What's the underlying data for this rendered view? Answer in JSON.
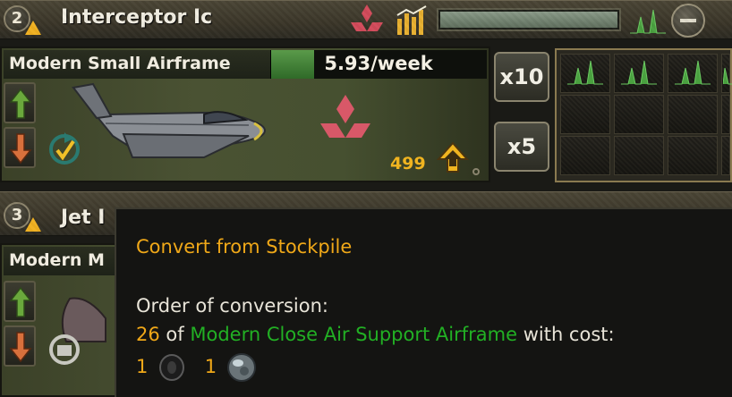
{
  "rows": [
    {
      "priority": "2",
      "title": "Interceptor Ic",
      "equipment_name": "Modern Small Airframe",
      "production_rate": "5.93/week",
      "stockpile_count": "499",
      "progress_fraction": 0.2
    },
    {
      "priority": "3",
      "title": "Jet I",
      "equipment_name": "Modern M"
    }
  ],
  "buttons": {
    "x10": "x10",
    "x5": "x5"
  },
  "tooltip": {
    "title": "Convert from Stockpile",
    "order_label": "Order of conversion:",
    "count": "26",
    "of_text": "of",
    "source_equipment": "Modern Close Air Support Airframe",
    "with_cost": "with cost:",
    "cost_1": "1",
    "cost_2": "1"
  },
  "icons": [
    "up-arrow-icon",
    "down-arrow-icon",
    "upgrade-cycle-icon",
    "mitsubishi-logo-icon",
    "efficiency-chart-icon",
    "minus-icon",
    "factory-chart-icon",
    "rubber-icon",
    "steel-icon",
    "plane-image"
  ],
  "colors": {
    "accent_yellow": "#f0a818",
    "accent_green": "#22b024",
    "brand_red": "#d05060"
  }
}
